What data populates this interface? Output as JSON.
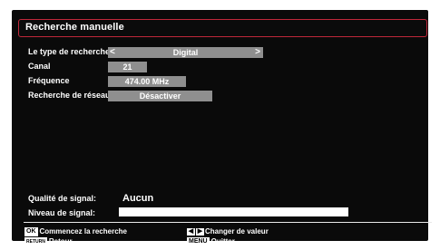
{
  "title": "Recherche manuelle",
  "fields": {
    "search_type": {
      "label": "Le type de recherche",
      "value": "Digital"
    },
    "channel": {
      "label": "Canal",
      "value": "21"
    },
    "frequency": {
      "label": "Fréquence",
      "value": "474.00 MHz"
    },
    "network_search": {
      "label": "Recherche de réseau",
      "value": "Désactiver"
    }
  },
  "signal": {
    "quality_label": "Qualité de signal:",
    "quality_value": "Aucun",
    "level_label": "Niveau de signal:",
    "level_fraction": 1.0
  },
  "footer": {
    "start": {
      "key": "OK",
      "label": "Commencez la recherche"
    },
    "back": {
      "key": "RETURN",
      "label": "Retour"
    },
    "change": {
      "key_left": "◀",
      "key_right": "▶",
      "label": "Changer de valeur"
    },
    "quit": {
      "key": "MENU",
      "label": "Quitter"
    }
  },
  "colors": {
    "frame_accent": "#c0283a",
    "value_box": "#8f8f8f",
    "background": "#0a0a0a"
  },
  "icons": {
    "left": "chevron-left-icon",
    "right": "chevron-right-icon"
  }
}
